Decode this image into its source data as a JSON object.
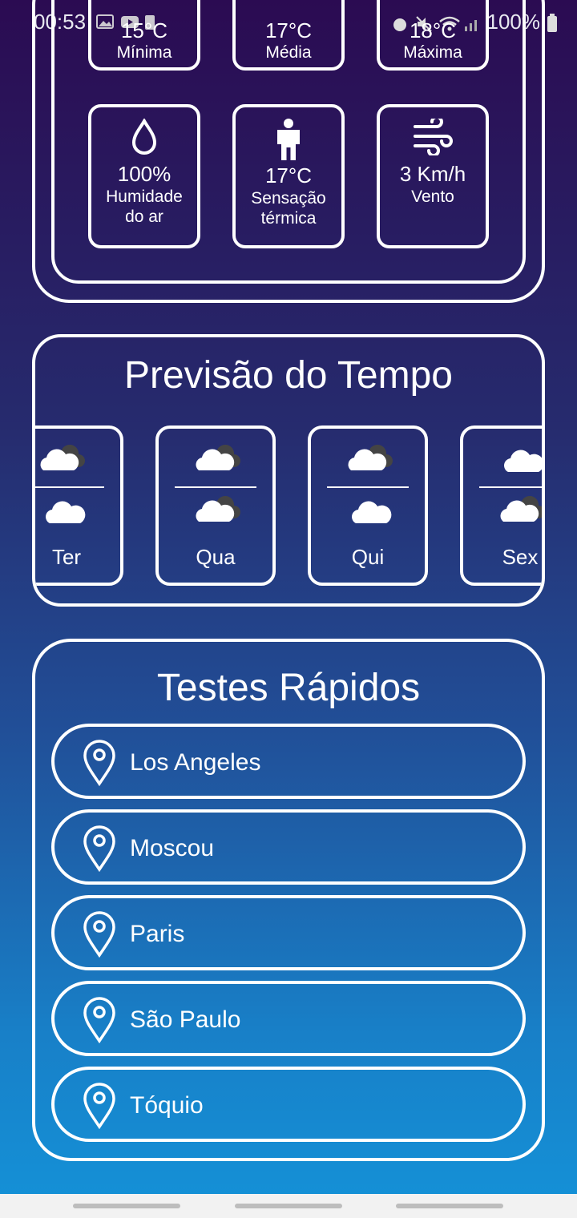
{
  "status_bar": {
    "time": "00:53",
    "battery": "100%"
  },
  "summary": {
    "top_tiles": [
      {
        "value": "15°C",
        "label": "Mínima"
      },
      {
        "value": "17°C",
        "label": "Média"
      },
      {
        "value": "18°C",
        "label": "Máxima"
      }
    ],
    "details": [
      {
        "icon": "water-drop-icon",
        "value": "100%",
        "label_line1": "Humidade",
        "label_line2": "do ar"
      },
      {
        "icon": "person-icon",
        "value": "17°C",
        "label_line1": "Sensação",
        "label_line2": "térmica"
      },
      {
        "icon": "wind-icon",
        "value": "3 Km/h",
        "label_line1": "Vento",
        "label_line2": ""
      }
    ]
  },
  "forecast": {
    "title": "Previsão do Tempo",
    "days": [
      {
        "name": "Ter",
        "top_icon": "cloudy-icon",
        "bottom_icon": "cloud-icon"
      },
      {
        "name": "Qua",
        "top_icon": "cloudy-icon",
        "bottom_icon": "cloudy-icon"
      },
      {
        "name": "Qui",
        "top_icon": "cloudy-icon",
        "bottom_icon": "cloud-icon"
      },
      {
        "name": "Sex",
        "top_icon": "cloud-icon",
        "bottom_icon": "cloudy-icon"
      }
    ]
  },
  "quick_tests": {
    "title": "Testes Rápidos",
    "cities": [
      "Los Angeles",
      "Moscou",
      "Paris",
      "São Paulo",
      "Tóquio"
    ]
  },
  "colors": {
    "accent": "#ffffff",
    "bg_top": "#2b0b52",
    "bg_bottom": "#1492d8"
  }
}
